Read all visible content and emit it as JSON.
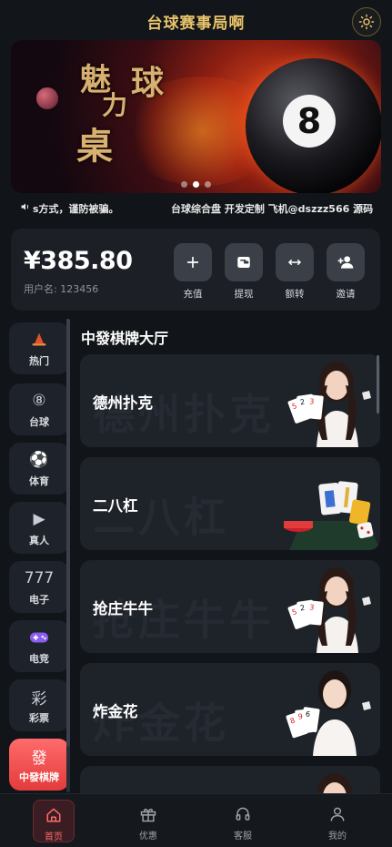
{
  "header": {
    "title": "台球赛事局啊",
    "theme_icon": "sun-icon"
  },
  "banner": {
    "art_text": [
      "魅",
      "力",
      "球",
      "桌"
    ],
    "ball_number": "8",
    "slide_count": 3,
    "active_slide": 2
  },
  "marquee": {
    "icon": "speaker-icon",
    "messages": [
      "s方式，谨防被骗。",
      "台球综合盘 开发定制 飞机@dszzz566 源码"
    ]
  },
  "wallet": {
    "balance": "¥385.80",
    "username": "用户名: 123456",
    "actions": [
      {
        "label": "充值",
        "icon": "plus-icon"
      },
      {
        "label": "提现",
        "icon": "wallet-icon"
      },
      {
        "label": "额转",
        "icon": "transfer-icon"
      },
      {
        "label": "邀请",
        "icon": "add-user-icon"
      }
    ]
  },
  "sidebar": {
    "items": [
      {
        "label": "热门",
        "icon": "flame-icon",
        "glyph": "▲"
      },
      {
        "label": "台球",
        "icon": "billiard-ball-icon",
        "glyph": "⑧"
      },
      {
        "label": "体育",
        "icon": "soccer-ball-icon",
        "glyph": "⚽"
      },
      {
        "label": "真人",
        "icon": "play-icon",
        "glyph": "▶"
      },
      {
        "label": "电子",
        "icon": "slot-777-icon",
        "glyph": "777"
      },
      {
        "label": "电竞",
        "icon": "gamepad-icon",
        "glyph": "🎮"
      },
      {
        "label": "彩票",
        "icon": "lottery-icon",
        "glyph": "彩"
      },
      {
        "label": "中發棋牌",
        "icon": "chess-card-icon",
        "glyph": "發"
      }
    ],
    "active_index": 7
  },
  "hall": {
    "title": "中發棋牌大厅",
    "games": [
      {
        "name": "德州扑克",
        "art": "dealer-cards"
      },
      {
        "name": "二八杠",
        "art": "mahjong-tiles"
      },
      {
        "name": "抢庄牛牛",
        "art": "dealer-cards"
      },
      {
        "name": "炸金花",
        "art": "dealer-cards"
      },
      {
        "name": "",
        "art": "dealer-cards"
      }
    ]
  },
  "tabbar": {
    "tabs": [
      {
        "label": "首页",
        "icon": "home-icon"
      },
      {
        "label": "优惠",
        "icon": "gift-icon"
      },
      {
        "label": "客服",
        "icon": "headset-icon"
      },
      {
        "label": "我的",
        "icon": "user-icon"
      }
    ],
    "active_index": 0
  }
}
